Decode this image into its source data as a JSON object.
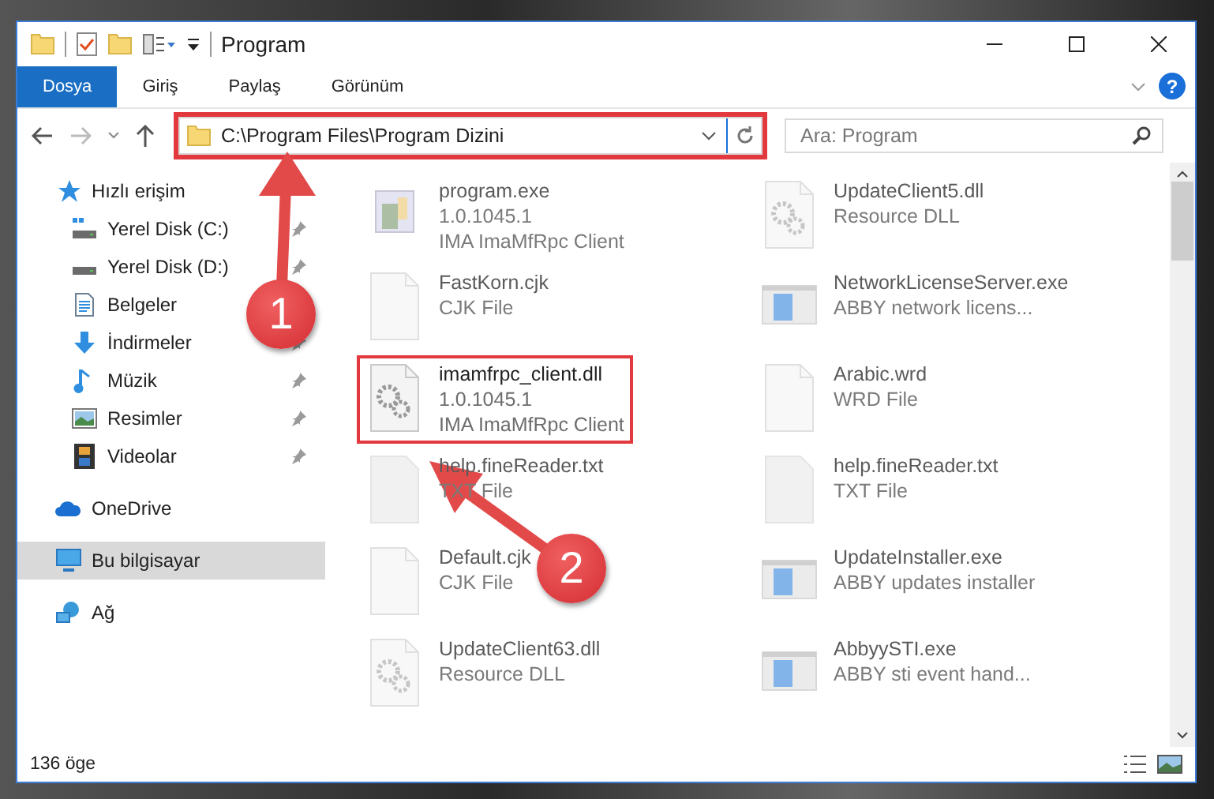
{
  "window": {
    "title": "Program"
  },
  "ribbon": {
    "tabs": [
      {
        "label": "Dosya",
        "selected": true
      },
      {
        "label": "Giriş",
        "selected": false
      },
      {
        "label": "Paylaş",
        "selected": false
      },
      {
        "label": "Görünüm",
        "selected": false
      }
    ],
    "help": "?"
  },
  "address_bar": {
    "path": "C:\\Program Files\\Program Dizini",
    "highlighted": true
  },
  "search": {
    "placeholder": "Ara: Program"
  },
  "sidebar": {
    "items": [
      {
        "label": "Hızlı erişim",
        "kind": "star",
        "selected": false,
        "children": [
          {
            "label": "Yerel Disk (C:)",
            "kind": "drive-c",
            "pinned": true,
            "selected": false
          },
          {
            "label": "Yerel Disk (D:)",
            "kind": "drive",
            "pinned": true,
            "selected": false
          },
          {
            "label": "Belgeler",
            "kind": "document",
            "selected": false
          },
          {
            "label": "İndirmeler",
            "kind": "download",
            "pinned": true,
            "selected": false
          },
          {
            "label": "Müzik",
            "kind": "music",
            "pinned": true,
            "selected": false
          },
          {
            "label": "Resimler",
            "kind": "pictures",
            "pinned": true,
            "selected": false
          },
          {
            "label": "Videolar",
            "kind": "video",
            "pinned": true,
            "selected": false
          }
        ]
      },
      {
        "label": "OneDrive",
        "kind": "cloud",
        "selected": false
      },
      {
        "label": "Bu bilgisayar",
        "kind": "computer",
        "selected": true
      },
      {
        "label": "Ağ",
        "kind": "network",
        "selected": false
      }
    ]
  },
  "files": [
    {
      "name": "program.exe",
      "kind": "exe",
      "lines": [
        "1.0.1045.1",
        "IMA ImaMfRpc Client"
      ],
      "blurred": true,
      "highlighted": false
    },
    {
      "name": "UpdateClient5.dll",
      "kind": "dll",
      "lines": [
        "Resource DLL"
      ],
      "blurred": true,
      "highlighted": false
    },
    {
      "name": "FastKorn.cjk",
      "kind": "file",
      "lines": [
        "CJK File"
      ],
      "blurred": true,
      "highlighted": false
    },
    {
      "name": "NetworkLicenseServer.exe",
      "kind": "app",
      "lines": [
        "ABBY network licens..."
      ],
      "blurred": true,
      "highlighted": false
    },
    {
      "name": "imamfrpc_client.dll",
      "kind": "dll",
      "lines": [
        "1.0.1045.1",
        "IMA ImaMfRpc Client"
      ],
      "blurred": false,
      "highlighted": true
    },
    {
      "name": "Arabic.wrd",
      "kind": "file",
      "lines": [
        "WRD File"
      ],
      "blurred": true,
      "highlighted": false
    },
    {
      "name": "help.fineReader.txt",
      "kind": "text",
      "lines": [
        "TXT File"
      ],
      "blurred": true,
      "highlighted": false
    },
    {
      "name": "help.fineReader.txt",
      "kind": "text",
      "lines": [
        "TXT File"
      ],
      "blurred": true,
      "highlighted": false
    },
    {
      "name": "Default.cjk",
      "kind": "file",
      "lines": [
        "CJK File"
      ],
      "blurred": true,
      "highlighted": false
    },
    {
      "name": "UpdateInstaller.exe",
      "kind": "app",
      "lines": [
        "ABBY updates installer"
      ],
      "blurred": true,
      "highlighted": false
    },
    {
      "name": "UpdateClient63.dll",
      "kind": "dll",
      "lines": [
        "Resource DLL"
      ],
      "blurred": true,
      "highlighted": false
    },
    {
      "name": "AbbyySTI.exe",
      "kind": "app",
      "lines": [
        "ABBY sti event hand..."
      ],
      "blurred": true,
      "highlighted": false
    }
  ],
  "status_bar": {
    "count": "136 öge"
  },
  "annotations": [
    {
      "label": "1"
    },
    {
      "label": "2"
    }
  ]
}
